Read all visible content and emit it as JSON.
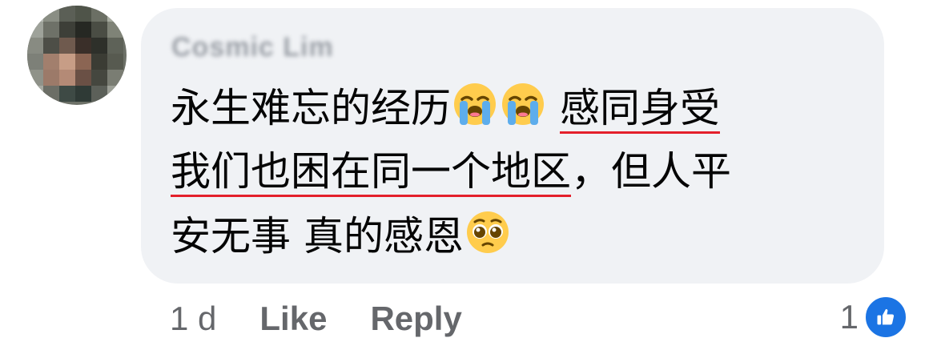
{
  "comment": {
    "author_name": "Cosmic Lim",
    "line1": {
      "text": "永生难忘的经历",
      "underlined": "感同身受"
    },
    "line2": {
      "underlined": "我们也困在同一个地区",
      "text": "，但人平"
    },
    "line3": {
      "text1": "安无事",
      "text2": "真的感恩"
    },
    "emojis": [
      "loudly-crying-face-emoji",
      "loudly-crying-face-emoji",
      "pleading-face-emoji"
    ],
    "underline_color": "#e4202b",
    "bubble_color": "#f0f2f5"
  },
  "footer": {
    "timestamp": "1 d",
    "like_label": "Like",
    "reply_label": "Reply",
    "reaction_count": "1",
    "reaction_icon": "like-thumb-icon",
    "reaction_color": "#1b74e4"
  }
}
